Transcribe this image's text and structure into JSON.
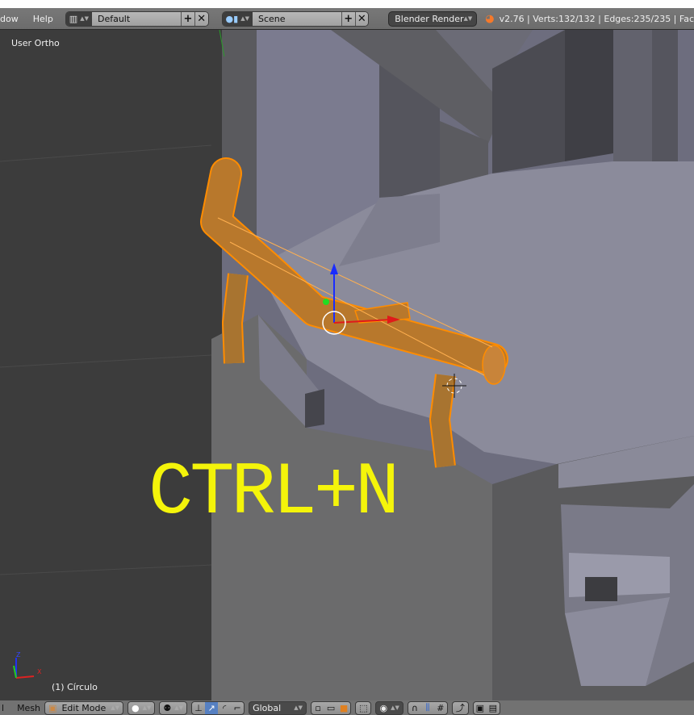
{
  "header": {
    "menus": [
      "dow",
      "Help"
    ],
    "screen_layout": {
      "icon": "screen-layout-icon",
      "value": "Default"
    },
    "scene": {
      "icon": "scene-icon",
      "value": "Scene"
    },
    "render_engine": "Blender Render",
    "stats": "v2.76 | Verts:132/132 | Edges:235/235 | Fac"
  },
  "viewport": {
    "view_label": "User Ortho",
    "object_label": "(1) Círculo",
    "overlay_text": "CTRL+N",
    "overlay_color": "#f4f40a",
    "selection_color": "#ff8c00",
    "axes": {
      "z": "Z",
      "x": "X"
    }
  },
  "footer": {
    "menus": [
      "l",
      "Mesh"
    ],
    "mode": "Edit Mode",
    "orientation": "Global"
  }
}
